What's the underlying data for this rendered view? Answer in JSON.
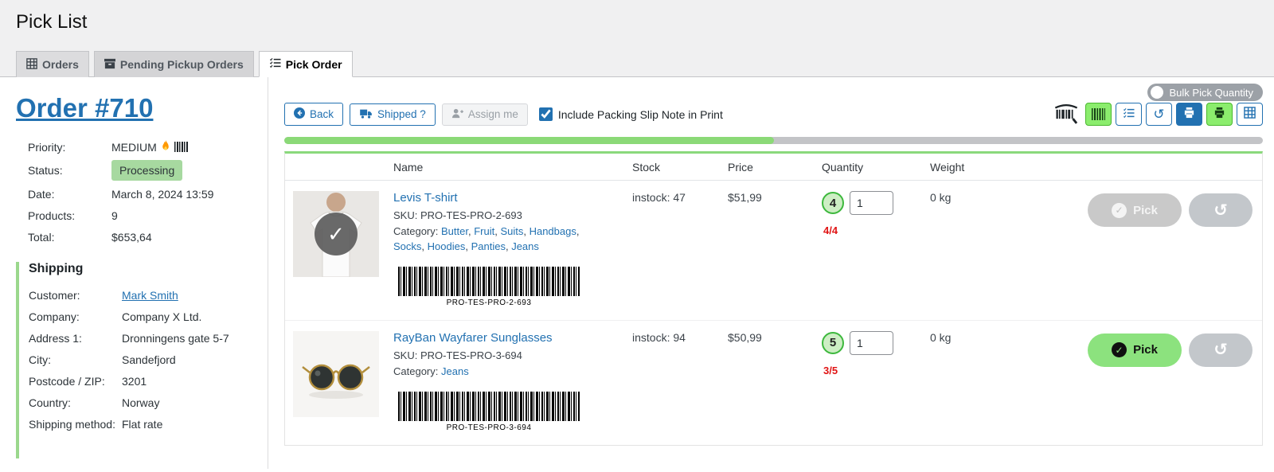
{
  "page": {
    "title": "Pick List"
  },
  "tabs": [
    {
      "label": "Orders"
    },
    {
      "label": "Pending Pickup Orders"
    },
    {
      "label": "Pick Order"
    }
  ],
  "order": {
    "title": "Order #710",
    "priority_label": "Priority:",
    "priority_value": "MEDIUM",
    "status_label": "Status:",
    "status_value": "Processing",
    "date_label": "Date:",
    "date_value": "March 8, 2024 13:59",
    "products_label": "Products:",
    "products_value": "9",
    "total_label": "Total:",
    "total_value": "$653,64",
    "shipping": {
      "title": "Shipping",
      "customer_label": "Customer:",
      "customer_value": "Mark Smith",
      "company_label": "Company:",
      "company_value": "Company X Ltd.",
      "address1_label": "Address 1:",
      "address1_value": "Dronningens gate 5-7",
      "city_label": "City:",
      "city_value": "Sandefjord",
      "postcode_label": "Postcode / ZIP:",
      "postcode_value": "3201",
      "country_label": "Country:",
      "country_value": "Norway",
      "method_label": "Shipping method:",
      "method_value": "Flat rate"
    }
  },
  "toolbar": {
    "back_label": "Back",
    "shipped_label": "Shipped ?",
    "assign_label": "Assign me",
    "packing_slip_label": "Include Packing Slip Note in Print",
    "packing_slip_checked": true,
    "bulk_pick_label": "Bulk Pick Quantity"
  },
  "icons": {
    "tab_orders": "table-icon",
    "tab_pending": "pickup-box-icon",
    "tab_pick": "list-check-icon",
    "back": "arrow-left-circle-icon",
    "shipped": "truck-icon",
    "assign": "person-plus-icon",
    "right_cluster": [
      "barcode-scanner-icon",
      "barcode-icon",
      "list-check-icon",
      "undo-icon",
      "print-icon",
      "print-icon",
      "grid-icon"
    ],
    "priority": [
      "flame-icon",
      "barcode-icon"
    ]
  },
  "progress": {
    "percent": 50
  },
  "table": {
    "headers": [
      "Name",
      "Stock",
      "Price",
      "Quantity",
      "Weight"
    ],
    "rows": [
      {
        "name": "Levis T-shirt",
        "sku": "SKU: PRO-TES-PRO-2-693",
        "category_label": "Category:",
        "categories": [
          "Butter",
          "Fruit",
          "Suits",
          "Handbags",
          "Socks",
          "Hoodies",
          "Panties",
          "Jeans"
        ],
        "barcode_text": "PRO-TES-PRO-2-693",
        "stock": "instock: 47",
        "price": "$51,99",
        "qty_badge": "4",
        "qty_input": "1",
        "qty_fraction": "4/4",
        "weight": "0 kg",
        "pick_label": "Pick",
        "pick_enabled": false,
        "picked": true
      },
      {
        "name": "RayBan Wayfarer Sunglasses",
        "sku": "SKU: PRO-TES-PRO-3-694",
        "category_label": "Category:",
        "categories": [
          "Jeans"
        ],
        "barcode_text": "PRO-TES-PRO-3-694",
        "stock": "instock: 94",
        "price": "$50,99",
        "qty_badge": "5",
        "qty_input": "1",
        "qty_fraction": "3/5",
        "weight": "0 kg",
        "pick_label": "Pick",
        "pick_enabled": true,
        "picked": false
      }
    ]
  },
  "colors": {
    "accent_blue": "#2271b1",
    "success_green": "#8bd977",
    "status_badge_green": "#a7d9a0",
    "danger_red": "#e01313"
  }
}
